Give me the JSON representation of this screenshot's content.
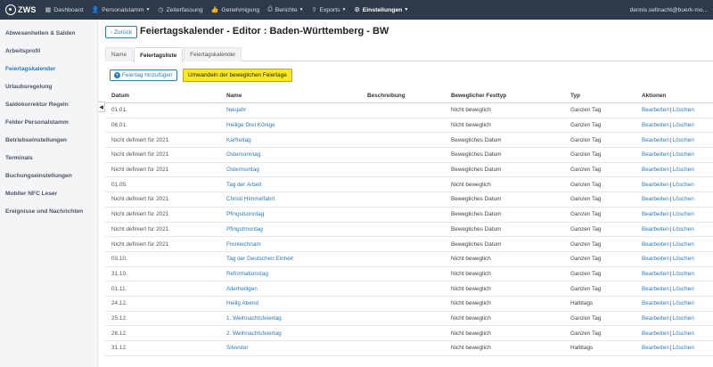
{
  "brand": {
    "name": "ZWS"
  },
  "nav": {
    "items": [
      {
        "icon": "dashboard-icon",
        "glyph": "▦",
        "label": "Dashboard",
        "caret": false,
        "active": false
      },
      {
        "icon": "user-icon",
        "glyph": "👤",
        "label": "Personalstamm",
        "caret": true,
        "active": false
      },
      {
        "icon": "clock-icon",
        "glyph": "◷",
        "label": "Zeiterfassung",
        "caret": false,
        "active": false
      },
      {
        "icon": "thumbs-up-icon",
        "glyph": "👍",
        "label": "Genehmigung",
        "caret": false,
        "active": false
      },
      {
        "icon": "printer-icon",
        "glyph": "⎙",
        "label": "Berichte",
        "caret": true,
        "active": false
      },
      {
        "icon": "export-icon",
        "glyph": "⇪",
        "label": "Exports",
        "caret": true,
        "active": false
      },
      {
        "icon": "gear-icon",
        "glyph": "⚙",
        "label": "Einstellungen",
        "caret": true,
        "active": true
      }
    ],
    "user": "dennis.sellnacht@buerk-mo..."
  },
  "sidebar": {
    "items": [
      {
        "label": "Abwesenheiten & Salden",
        "active": false
      },
      {
        "label": "Arbeitsprofil",
        "active": false
      },
      {
        "label": "Feiertagskalender",
        "active": true
      },
      {
        "label": "Urlaubsregelung",
        "active": false
      },
      {
        "label": "Saldokorrektur Regeln",
        "active": false
      },
      {
        "label": "Felder Personalstamm",
        "active": false
      },
      {
        "label": "Betriebseinstellungen",
        "active": false
      },
      {
        "label": "Terminals",
        "active": false
      },
      {
        "label": "Buchungseinstellungen",
        "active": false
      },
      {
        "label": "Mobiler NFC Leser",
        "active": false
      },
      {
        "label": "Ereignisse und Nachrichten",
        "active": false
      }
    ],
    "collapse_glyph": "◀"
  },
  "header": {
    "back_label": "‹ Zurück",
    "title": "Feiertagskalender - Editor : Baden-Württemberg - BW"
  },
  "tabs": [
    {
      "label": "Name",
      "active": false
    },
    {
      "label": "Feiertagsliste",
      "active": true
    },
    {
      "label": "Feiertagskalender",
      "active": false
    }
  ],
  "toolbar": {
    "add_plus": "+",
    "add_label": "Feiertag hinzufügen",
    "convert_label": "Umwandeln der beweglichen Feiertage"
  },
  "table": {
    "columns": {
      "datum": "Datum",
      "name": "Name",
      "beschreibung": "Beschreibung",
      "festtyp": "Beweglicher Festtyp",
      "typ": "Typ",
      "aktionen": "Aktionen"
    },
    "edit_label": "Bearbeiten",
    "action_sep": "|",
    "delete_label": "Löschen",
    "rows": [
      {
        "datum": "01.01.",
        "name": "Neujahr",
        "beschreibung": "",
        "festtyp": "Nicht beweglich",
        "typ": "Ganzen Tag"
      },
      {
        "datum": "06.01.",
        "name": "Heilige Drei Könige",
        "beschreibung": "",
        "festtyp": "Nicht beweglich",
        "typ": "Ganzen Tag"
      },
      {
        "datum": "Nicht definiert für 2021",
        "name": "Karfreitag",
        "beschreibung": "",
        "festtyp": "Bewegliches Datum",
        "typ": "Ganzen Tag"
      },
      {
        "datum": "Nicht definiert für 2021",
        "name": "Ostersonntag",
        "beschreibung": "",
        "festtyp": "Bewegliches Datum",
        "typ": "Ganzen Tag"
      },
      {
        "datum": "Nicht definiert für 2021",
        "name": "Ostermontag",
        "beschreibung": "",
        "festtyp": "Bewegliches Datum",
        "typ": "Ganzen Tag"
      },
      {
        "datum": "01.05.",
        "name": "Tag der Arbeit",
        "beschreibung": "",
        "festtyp": "Nicht beweglich",
        "typ": "Ganzen Tag"
      },
      {
        "datum": "Nicht definiert für 2021",
        "name": "Christi Himmelfahrt",
        "beschreibung": "",
        "festtyp": "Bewegliches Datum",
        "typ": "Ganzen Tag"
      },
      {
        "datum": "Nicht definiert für 2021",
        "name": "Pfingstsonntag",
        "beschreibung": "",
        "festtyp": "Bewegliches Datum",
        "typ": "Ganzen Tag"
      },
      {
        "datum": "Nicht definiert für 2021",
        "name": "Pfingstmontag",
        "beschreibung": "",
        "festtyp": "Bewegliches Datum",
        "typ": "Ganzen Tag"
      },
      {
        "datum": "Nicht definiert für 2021",
        "name": "Fronleichnam",
        "beschreibung": "",
        "festtyp": "Bewegliches Datum",
        "typ": "Ganzen Tag"
      },
      {
        "datum": "03.10.",
        "name": "Tag der Deutschen Einheit",
        "beschreibung": "",
        "festtyp": "Nicht beweglich",
        "typ": "Ganzen Tag"
      },
      {
        "datum": "31.10.",
        "name": "Reformationstag",
        "beschreibung": "",
        "festtyp": "Nicht beweglich",
        "typ": "Ganzen Tag"
      },
      {
        "datum": "01.11.",
        "name": "Allerheiligen",
        "beschreibung": "",
        "festtyp": "Nicht beweglich",
        "typ": "Ganzen Tag"
      },
      {
        "datum": "24.12.",
        "name": "Heilig Abend",
        "beschreibung": "",
        "festtyp": "Nicht beweglich",
        "typ": "Halbtags"
      },
      {
        "datum": "25.12.",
        "name": "1. Weihnachtsfeiertag",
        "beschreibung": "",
        "festtyp": "Nicht beweglich",
        "typ": "Ganzen Tag"
      },
      {
        "datum": "26.12.",
        "name": "2. Weihnachtsfeiertag",
        "beschreibung": "",
        "festtyp": "Nicht beweglich",
        "typ": "Ganzen Tag"
      },
      {
        "datum": "31.12.",
        "name": "Silvester",
        "beschreibung": "",
        "festtyp": "Nicht beweglich",
        "typ": "Halbtags"
      }
    ]
  }
}
